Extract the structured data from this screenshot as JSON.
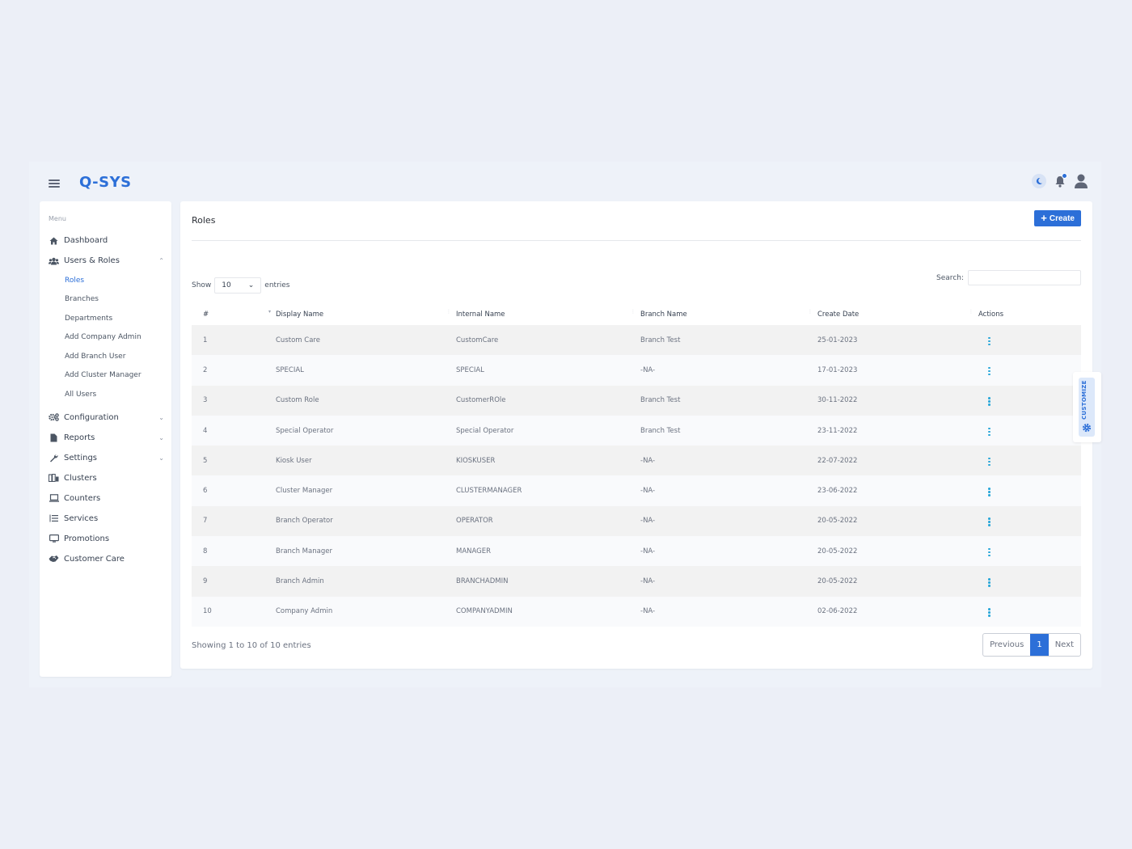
{
  "app": {
    "title": "Q-SYS"
  },
  "topbar": {
    "icons": [
      "moon-icon",
      "bell-icon",
      "user-icon"
    ],
    "accent_color": "#2c6fd8"
  },
  "sidebar": {
    "menu_label": "Menu",
    "items": [
      {
        "label": "Dashboard",
        "icon": "home-icon"
      },
      {
        "label": "Users & Roles",
        "icon": "users-icon",
        "expanded": true,
        "children": [
          {
            "label": "Roles",
            "active": true
          },
          {
            "label": "Branches"
          },
          {
            "label": "Departments"
          },
          {
            "label": "Add Company Admin"
          },
          {
            "label": "Add Branch User"
          },
          {
            "label": "Add Cluster Manager"
          },
          {
            "label": "All Users"
          }
        ]
      },
      {
        "label": "Configuration",
        "icon": "cogs-icon",
        "has_children": true
      },
      {
        "label": "Reports",
        "icon": "file-icon",
        "has_children": true
      },
      {
        "label": "Settings",
        "icon": "wrench-icon",
        "has_children": true
      },
      {
        "label": "Clusters",
        "icon": "building-icon"
      },
      {
        "label": "Counters",
        "icon": "laptop-icon"
      },
      {
        "label": "Services",
        "icon": "list-icon"
      },
      {
        "label": "Promotions",
        "icon": "monitor-icon"
      },
      {
        "label": "Customer Care",
        "icon": "handshake-icon"
      }
    ]
  },
  "main": {
    "title": "Roles",
    "create_label": "Create",
    "show_label": "Show",
    "entries_label": "entries",
    "page_size": "10",
    "search_label": "Search:",
    "search_value": "",
    "columns": [
      "#",
      "Display Name",
      "Internal Name",
      "Branch Name",
      "Create Date",
      "Actions"
    ],
    "rows": [
      {
        "n": "1",
        "display": "Custom Care",
        "internal": "CustomCare",
        "branch": "Branch Test",
        "date": "25-01-2023"
      },
      {
        "n": "2",
        "display": "SPECIAL",
        "internal": "SPECIAL",
        "branch": "-NA-",
        "date": "17-01-2023"
      },
      {
        "n": "3",
        "display": "Custom Role",
        "internal": "CustomerROle",
        "branch": "Branch Test",
        "date": "30-11-2022"
      },
      {
        "n": "4",
        "display": "Special Operator",
        "internal": "Special Operator",
        "branch": "Branch Test",
        "date": "23-11-2022"
      },
      {
        "n": "5",
        "display": "Kiosk User",
        "internal": "KIOSKUSER",
        "branch": "-NA-",
        "date": "22-07-2022"
      },
      {
        "n": "6",
        "display": "Cluster Manager",
        "internal": "CLUSTERMANAGER",
        "branch": "-NA-",
        "date": "23-06-2022"
      },
      {
        "n": "7",
        "display": "Branch Operator",
        "internal": "OPERATOR",
        "branch": "-NA-",
        "date": "20-05-2022"
      },
      {
        "n": "8",
        "display": "Branch Manager",
        "internal": "MANAGER",
        "branch": "-NA-",
        "date": "20-05-2022"
      },
      {
        "n": "9",
        "display": "Branch Admin",
        "internal": "BRANCHADMIN",
        "branch": "-NA-",
        "date": "20-05-2022"
      },
      {
        "n": "10",
        "display": "Company Admin",
        "internal": "COMPANYADMIN",
        "branch": "-NA-",
        "date": "02-06-2022"
      }
    ],
    "info_text": "Showing 1 to 10 of 10 entries",
    "pagination": {
      "previous": "Previous",
      "current": "1",
      "next": "Next"
    }
  },
  "customize": {
    "label": "CUSTOMIZE"
  }
}
